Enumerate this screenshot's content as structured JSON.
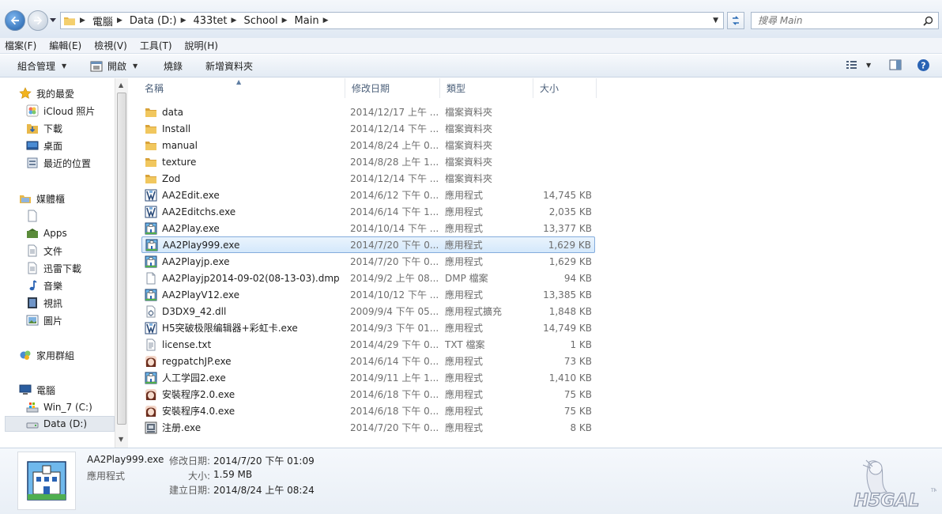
{
  "address": {
    "crumbs": [
      "電腦",
      "Data (D:)",
      "433tet",
      "School",
      "Main"
    ],
    "search_placeholder": "搜尋 Main"
  },
  "menu": [
    "檔案(F)",
    "編輯(E)",
    "檢視(V)",
    "工具(T)",
    "說明(H)"
  ],
  "toolbar": {
    "organize": "組合管理",
    "open": "開啟",
    "burn": "燒錄",
    "new_folder": "新增資料夾"
  },
  "sidebar": {
    "favorites": "我的最愛",
    "fav_items": [
      "iCloud 照片",
      "下載",
      "桌面",
      "最近的位置"
    ],
    "libraries": "媒體櫃",
    "lib_items": [
      "",
      "Apps",
      "文件",
      "迅雷下載",
      "音樂",
      "視訊",
      "圖片"
    ],
    "homegroup": "家用群組",
    "computer": "電腦",
    "drives": [
      "Win_7 (C:)",
      "Data (D:)"
    ]
  },
  "columns": {
    "name": "名稱",
    "date": "修改日期",
    "type": "類型",
    "size": "大小"
  },
  "files": [
    {
      "name": "data",
      "date": "2014/12/17 上午 ...",
      "type": "檔案資料夾",
      "size": "",
      "icon": "folder-icon"
    },
    {
      "name": "Install",
      "date": "2014/12/14 下午 ...",
      "type": "檔案資料夾",
      "size": "",
      "icon": "folder-icon"
    },
    {
      "name": "manual",
      "date": "2014/8/24 上午 0...",
      "type": "檔案資料夾",
      "size": "",
      "icon": "folder-icon"
    },
    {
      "name": "texture",
      "date": "2014/8/28 上午 1...",
      "type": "檔案資料夾",
      "size": "",
      "icon": "folder-icon"
    },
    {
      "name": "Zod",
      "date": "2014/12/14 下午 ...",
      "type": "檔案資料夾",
      "size": "",
      "icon": "folder-icon"
    },
    {
      "name": "AA2Edit.exe",
      "date": "2014/6/12 下午 0...",
      "type": "應用程式",
      "size": "14,745 KB",
      "icon": "editor-app-icon"
    },
    {
      "name": "AA2Editchs.exe",
      "date": "2014/6/14 下午 1...",
      "type": "應用程式",
      "size": "2,035 KB",
      "icon": "editor-app-icon"
    },
    {
      "name": "AA2Play.exe",
      "date": "2014/10/14 下午 ...",
      "type": "應用程式",
      "size": "13,377 KB",
      "icon": "school-app-icon"
    },
    {
      "name": "AA2Play999.exe",
      "date": "2014/7/20 下午 0...",
      "type": "應用程式",
      "size": "1,629 KB",
      "icon": "school-app-icon"
    },
    {
      "name": "AA2Playjp.exe",
      "date": "2014/7/20 下午 0...",
      "type": "應用程式",
      "size": "1,629 KB",
      "icon": "school-app-icon"
    },
    {
      "name": "AA2Playjp2014-09-02(08-13-03).dmp",
      "date": "2014/9/2 上午 08...",
      "type": "DMP 檔案",
      "size": "94 KB",
      "icon": "document-icon"
    },
    {
      "name": "AA2PlayV12.exe",
      "date": "2014/10/12 下午 ...",
      "type": "應用程式",
      "size": "13,385 KB",
      "icon": "school-app-icon"
    },
    {
      "name": "D3DX9_42.dll",
      "date": "2009/9/4 下午 05...",
      "type": "應用程式擴充",
      "size": "1,848 KB",
      "icon": "dll-icon"
    },
    {
      "name": "H5突破极限编辑器+彩虹卡.exe",
      "date": "2014/9/3 下午 01...",
      "type": "應用程式",
      "size": "14,749 KB",
      "icon": "editor-app-icon"
    },
    {
      "name": "license.txt",
      "date": "2014/4/29 下午 0...",
      "type": "TXT 檔案",
      "size": "1 KB",
      "icon": "text-file-icon"
    },
    {
      "name": "regpatchJP.exe",
      "date": "2014/6/14 下午 0...",
      "type": "應用程式",
      "size": "73 KB",
      "icon": "portrait-app-icon"
    },
    {
      "name": "人工学园2.exe",
      "date": "2014/9/11 上午 1...",
      "type": "應用程式",
      "size": "1,410 KB",
      "icon": "school-app-icon"
    },
    {
      "name": "安裝程序2.0.exe",
      "date": "2014/6/18 下午 0...",
      "type": "應用程式",
      "size": "75 KB",
      "icon": "portrait-app-icon"
    },
    {
      "name": "安裝程序4.0.exe",
      "date": "2014/6/18 下午 0...",
      "type": "應用程式",
      "size": "75 KB",
      "icon": "portrait-app-icon"
    },
    {
      "name": "注册.exe",
      "date": "2014/7/20 下午 0...",
      "type": "應用程式",
      "size": "8 KB",
      "icon": "register-app-icon"
    }
  ],
  "selected_index": 8,
  "details": {
    "filename": "AA2Play999.exe",
    "filetype": "應用程式",
    "modified_label": "修改日期:",
    "modified_value": "2014/7/20 下午 01:09",
    "size_label": "大小:",
    "size_value": "1.59 MB",
    "created_label": "建立日期:",
    "created_value": "2014/8/24 上午 08:24"
  },
  "colors": {
    "selection": "#cce4f7",
    "accent": "#1f5ea8",
    "folder": "#e8b84a"
  }
}
